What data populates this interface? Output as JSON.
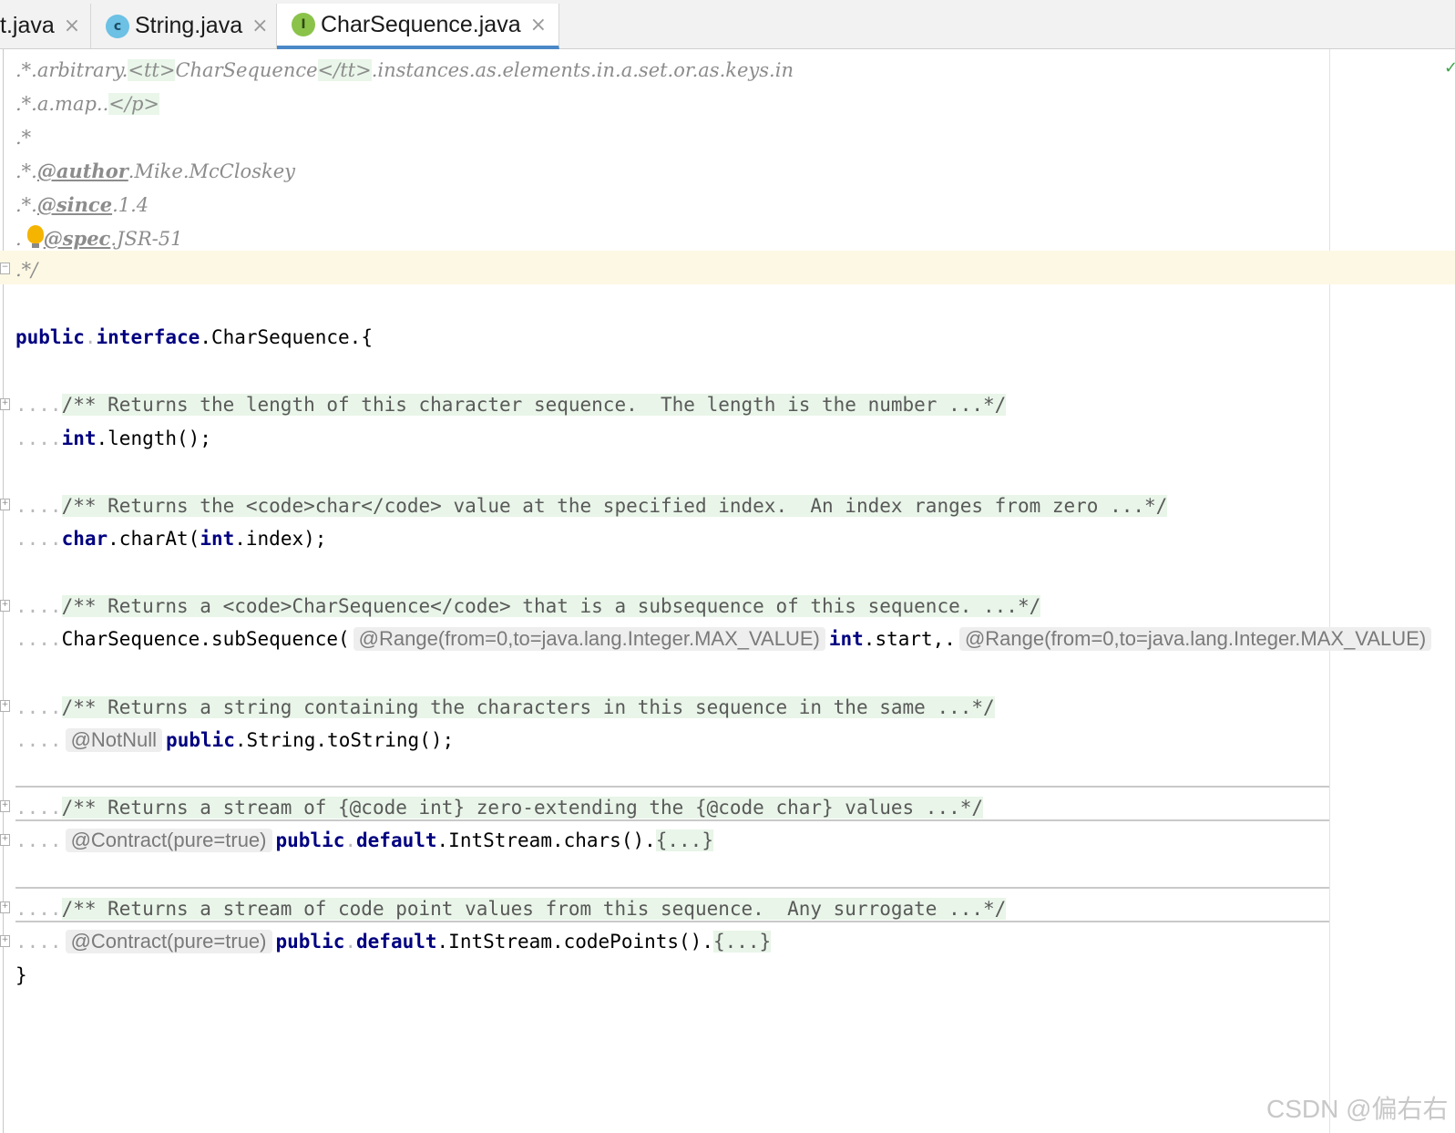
{
  "tabs": [
    {
      "label": "t.java",
      "icon": "java-class-icon"
    },
    {
      "label": "String.java",
      "icon": "class-icon",
      "icon_letter": "c"
    },
    {
      "label": "CharSequence.java",
      "icon": "interface-icon",
      "icon_letter": "I",
      "active": true
    }
  ],
  "tab_close_glyph": "×",
  "colors": {
    "keyword": "#000080",
    "javadoc": "#8c8c8c",
    "fold_bg": "#e8f5e8",
    "caret_line": "#fdf8e3",
    "active_tab_underline": "#4a88c7"
  },
  "code": {
    "l1": {
      "lead": ".*.",
      "text1": "arbitrary.",
      "tag_open": "<tt>",
      "mid": "CharSequence",
      "tag_close": "</tt>",
      "rest": ".instances.as.elements.in.a.set.or.as.keys.in"
    },
    "l2": {
      "lead": ".*.",
      "text": "a.map..",
      "tag": "</p>"
    },
    "l3": {
      "lead": ".*"
    },
    "l4": {
      "lead": ".*.",
      "tag": "@author",
      "text": ".Mike.McCloskey"
    },
    "l5": {
      "lead": ".*.",
      "tag": "@since",
      "text": ".1.4"
    },
    "l6": {
      "lead": ".",
      "tag": "@spec",
      "text": ".JSR-51"
    },
    "l7": {
      "text": ".*/"
    },
    "l8": {
      "kw1": "public",
      "sp": ".",
      "kw2": "interface",
      "rest": ".CharSequence.{"
    },
    "l9": {
      "indent": "....",
      "doc": "/** Returns the length of this character sequence.  The length is the number ...*/"
    },
    "l10": {
      "indent": "....",
      "kw": "int",
      "rest": ".length();"
    },
    "l11": {
      "indent": "....",
      "doc": "/** Returns the <code>char</code> value at the specified index.  An index ranges from zero ...*/"
    },
    "l12": {
      "indent": "....",
      "kw": "char",
      "mid": ".charAt(",
      "kw2": "int",
      "rest": ".index);"
    },
    "l13": {
      "indent": "....",
      "doc": "/** Returns a <code>CharSequence</code> that is a subsequence of this sequence. ...*/"
    },
    "l14": {
      "indent": "....",
      "text": "CharSequence.subSequence(",
      "hint1": "@Range(from=0,to=java.lang.Integer.MAX_VALUE)",
      "kw": "int",
      "mid": ".start,.",
      "hint2": "@Range(from=0,to=java.lang.Integer.MAX_VALUE)"
    },
    "l15": {
      "indent": "....",
      "doc": "/** Returns a string containing the characters in this sequence in the same ...*/"
    },
    "l16": {
      "indent": "....",
      "hint": "@NotNull",
      "kw": "public",
      "rest": ".String.toString();"
    },
    "l17": {
      "indent": "....",
      "doc": "/** Returns a stream of {@code int} zero-extending the {@code char} values ...*/"
    },
    "l18": {
      "indent": "....",
      "hint": "@Contract(pure=true)",
      "kw1": "public",
      "kw2": "default",
      "rest": ".IntStream.chars().",
      "fold": "{...}"
    },
    "l19": {
      "indent": "....",
      "doc": "/** Returns a stream of code point values from this sequence.  Any surrogate ...*/"
    },
    "l20": {
      "indent": "....",
      "hint": "@Contract(pure=true)",
      "kw1": "public",
      "kw2": "default",
      "rest": ".IntStream.codePoints().",
      "fold": "{...}"
    },
    "l21": {
      "text": "}"
    }
  },
  "watermark": "CSDN @偏右右"
}
